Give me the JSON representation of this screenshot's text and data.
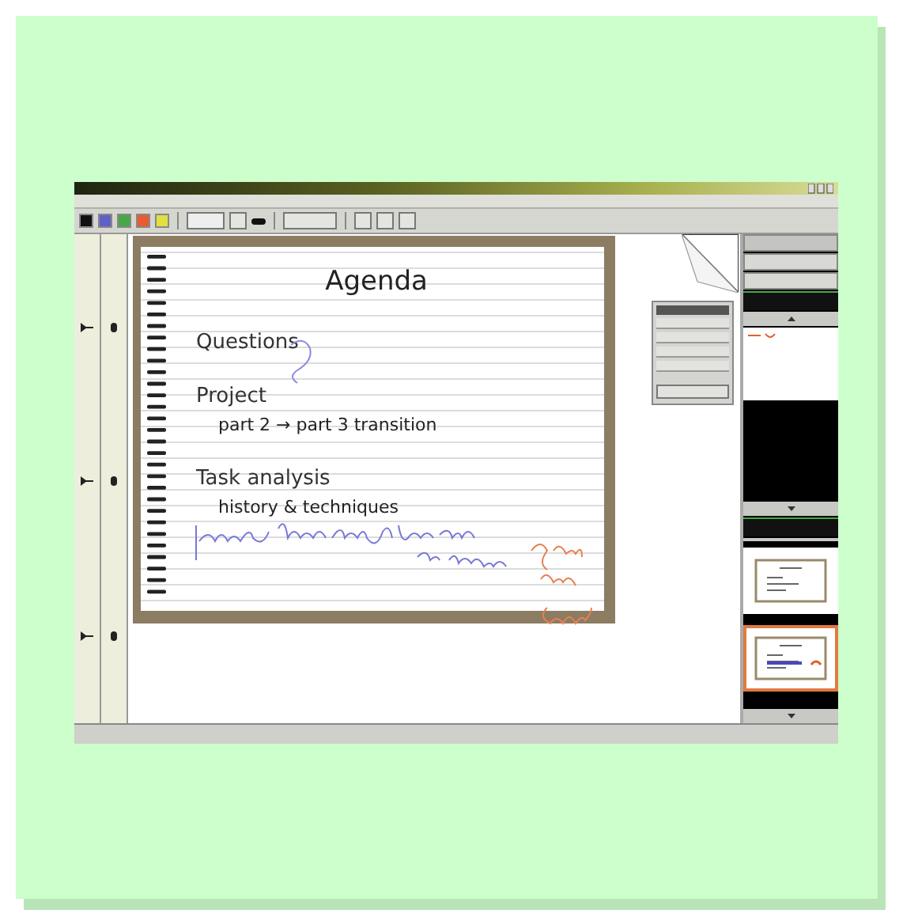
{
  "toolbar": {
    "pens": [
      {
        "color": "#111111"
      },
      {
        "color": "#6060c8"
      },
      {
        "color": "#48a848"
      },
      {
        "color": "#e85a30"
      },
      {
        "color": "#e0e040"
      }
    ]
  },
  "slide": {
    "title": "Agenda",
    "items": [
      {
        "kind": "heading",
        "text": "Questions"
      },
      {
        "kind": "heading",
        "text": "Project"
      },
      {
        "kind": "sub",
        "text": "part 2 → part 3 transition"
      },
      {
        "kind": "heading",
        "text": "Task analysis"
      },
      {
        "kind": "sub",
        "text": "history & techniques"
      }
    ]
  },
  "thumbnails": [
    {
      "selected": false
    },
    {
      "selected": true
    }
  ]
}
